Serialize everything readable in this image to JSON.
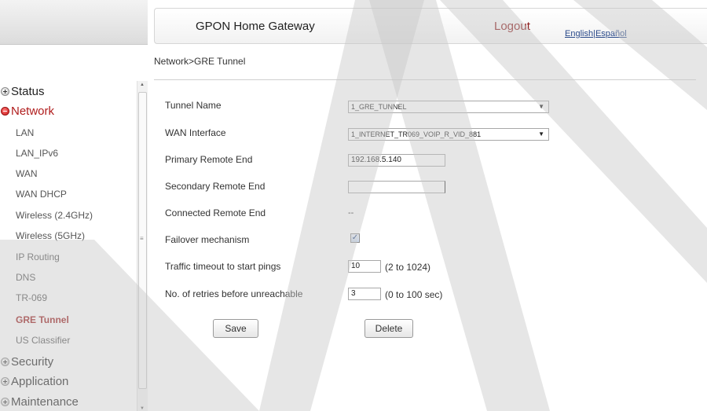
{
  "header": {
    "title": "GPON Home Gateway",
    "logout_label": "Logout",
    "lang_english": "English",
    "lang_separator": "|",
    "lang_spanish": "Español"
  },
  "breadcrumb": "Network>GRE Tunnel",
  "sidebar": {
    "sections": [
      {
        "label": "Status",
        "state": "collapsed"
      },
      {
        "label": "Network",
        "state": "expanded"
      },
      {
        "label": "Security",
        "state": "collapsed"
      },
      {
        "label": "Application",
        "state": "collapsed"
      },
      {
        "label": "Maintenance",
        "state": "collapsed"
      }
    ],
    "network_items": [
      "LAN",
      "LAN_IPv6",
      "WAN",
      "WAN DHCP",
      "Wireless (2.4GHz)",
      "Wireless (5GHz)",
      "IP Routing",
      "DNS",
      "TR-069",
      "GRE Tunnel",
      "US Classifier"
    ],
    "selected_item": "GRE Tunnel"
  },
  "form": {
    "tunnel_name": {
      "label": "Tunnel Name",
      "value": "1_GRE_TUNNEL"
    },
    "wan_interface": {
      "label": "WAN Interface",
      "value": "1_INTERNET_TR069_VOIP_R_VID_881"
    },
    "primary_remote_end": {
      "label": "Primary Remote End",
      "value": "192.168.5.140"
    },
    "secondary_remote_end": {
      "label": "Secondary Remote End",
      "value": ""
    },
    "connected_remote_end": {
      "label": "Connected Remote End",
      "value": "--"
    },
    "failover": {
      "label": "Failover mechanism",
      "checked": true,
      "check_glyph": "✓"
    },
    "traffic_timeout": {
      "label": "Traffic timeout to start pings",
      "value": "10",
      "hint": "(2 to 1024)"
    },
    "retries": {
      "label": "No. of retries before unreachable",
      "value": "3",
      "hint": "(0 to 100 sec)"
    }
  },
  "buttons": {
    "save": "Save",
    "delete": "Delete"
  },
  "colors": {
    "active_red": "#b01c1c",
    "logout_red": "#8b1a1a",
    "link_blue": "#2a4a8a"
  }
}
